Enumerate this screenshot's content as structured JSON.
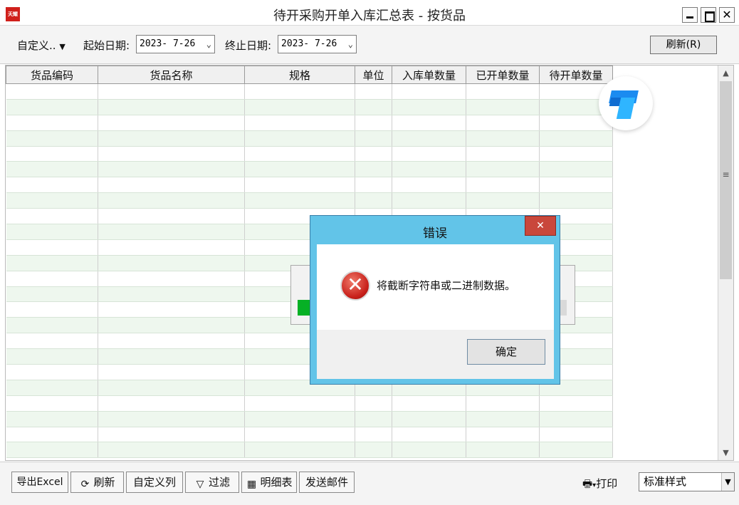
{
  "window": {
    "logo_text": "天耀",
    "title": "待开采购开单入库汇总表 - 按货品",
    "close_glyph": "✕"
  },
  "toolbar": {
    "custom_label": "自定义..",
    "start_label": "起始日期:",
    "start_value": "2023- 7-26",
    "end_label": "终止日期:",
    "end_value": "2023- 7-26",
    "refresh_label": "刷新(R)"
  },
  "table": {
    "columns": [
      "货品编码",
      "货品名称",
      "规格",
      "单位",
      "入库单数量",
      "已开单数量",
      "待开单数量"
    ],
    "rows": []
  },
  "dialog": {
    "title": "错误",
    "close_glyph": "✕",
    "icon_glyph": "✕",
    "message": "将截断字符串或二进制数据。",
    "ok_label": "确定"
  },
  "bottom": {
    "export_label": "导出Excel",
    "refresh_label": "刷新",
    "custom_cols_label": "自定义列",
    "filter_label": "过滤",
    "detail_label": "明细表",
    "email_label": "发送邮件",
    "print_label": "打印",
    "style_value": "标准样式"
  },
  "colors": {
    "dialog_frame": "#62c4e8",
    "close_red": "#c9473b",
    "row_alt_green": "#eef7ee",
    "progress_green": "#06b025"
  }
}
